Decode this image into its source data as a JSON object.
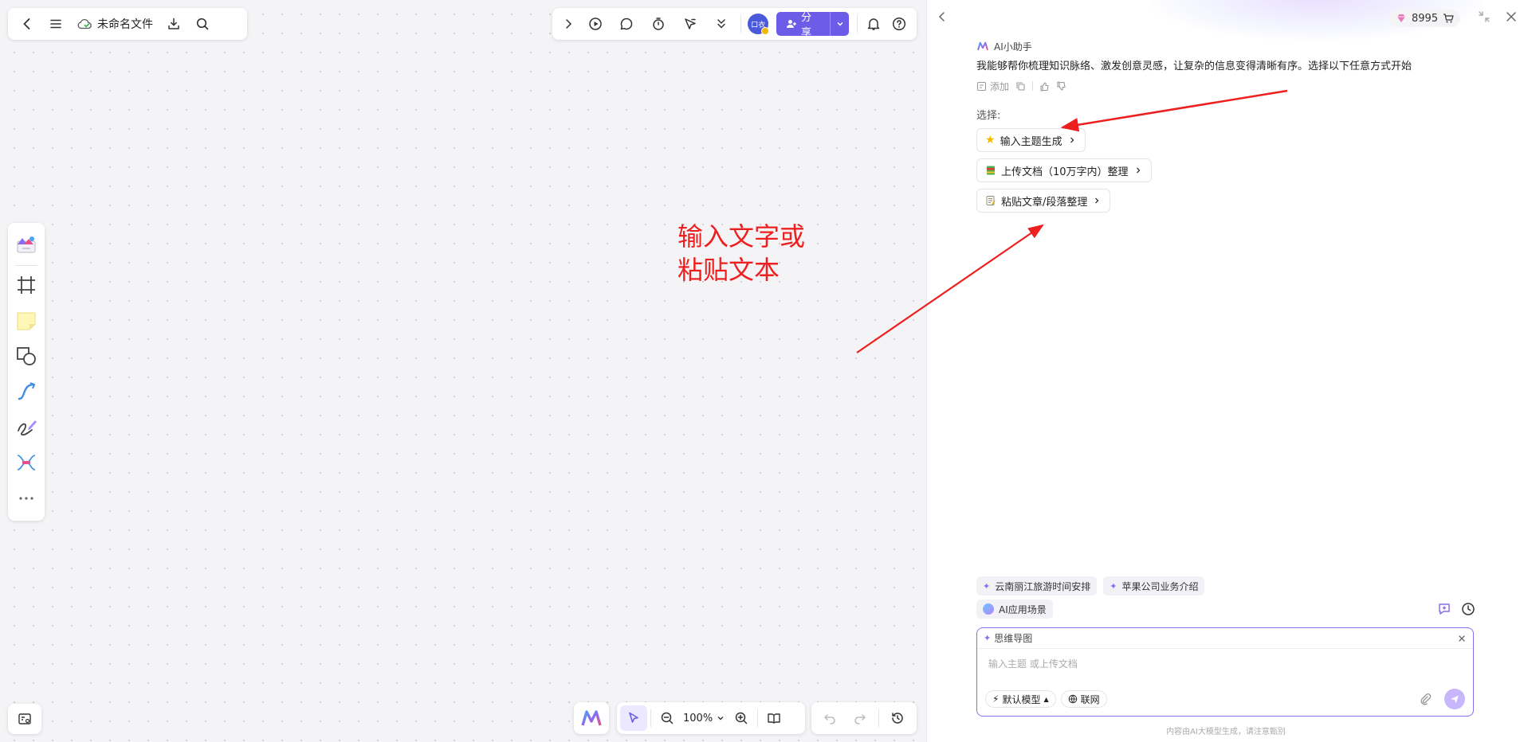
{
  "file": {
    "name": "未命名文件"
  },
  "toolbar": {
    "share_label": "分享",
    "avatar_text": "口衣"
  },
  "zoom": {
    "level": "100%"
  },
  "annotation": {
    "line1": "输入文字或",
    "line2": "粘贴文本"
  },
  "ai": {
    "credits": "8995",
    "assistant_name": "AI小助手",
    "message": "我能够帮你梳理知识脉络、激发创意灵感，让复杂的信息变得清晰有序。选择以下任意方式开始",
    "add_label": "添加",
    "choose_label": "选择:",
    "options": [
      {
        "label": "输入主题生成",
        "icon": "star-icon"
      },
      {
        "label": "上传文档（10万字内）整理",
        "icon": "book-icon"
      },
      {
        "label": "粘贴文章/段落整理",
        "icon": "memo-icon"
      }
    ],
    "suggestions": [
      "云南丽江旅游时间安排",
      "苹果公司业务介绍"
    ],
    "apps_label": "AI应用场景",
    "input": {
      "mode": "思维导图",
      "placeholder": "输入主题 或上传文档",
      "model_label": "默认模型",
      "web_label": "联网"
    },
    "footer": "内容由AI大模型生成，请注意甄别"
  },
  "colors": {
    "accent": "#6c5ce7",
    "annotation": "#ee1f1f"
  }
}
